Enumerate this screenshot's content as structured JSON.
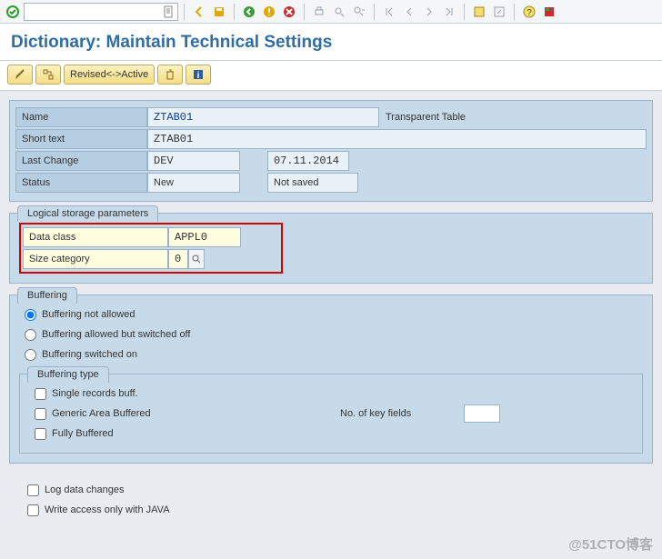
{
  "toolbar": {
    "ok_tip": "Enter",
    "combo_value": ""
  },
  "page_title": "Dictionary: Maintain Technical Settings",
  "local_toolbar": {
    "revise_label": "Revised<->Active"
  },
  "info": {
    "name_label": "Name",
    "name_value": "ZTAB01",
    "type_value": "Transparent Table",
    "short_text_label": "Short text",
    "short_text_value": "ZTAB01",
    "last_change_label": "Last Change",
    "last_change_user": "DEV",
    "last_change_date": "07.11.2014",
    "status_label": "Status",
    "status_value": "New",
    "saved_value": "Not saved"
  },
  "storage": {
    "group_title": "Logical storage parameters",
    "data_class_label": "Data class",
    "data_class_value": "APPL0",
    "size_cat_label": "Size category",
    "size_cat_value": "0"
  },
  "buffering": {
    "group_title": "Buffering",
    "opt_not_allowed": "Buffering not allowed",
    "opt_switched_off": "Buffering allowed but switched off",
    "opt_switched_on": "Buffering switched on",
    "selected": "not_allowed"
  },
  "buffering_type": {
    "group_title": "Buffering type",
    "single": "Single records buff.",
    "generic": "Generic Area Buffered",
    "fully": "Fully Buffered",
    "key_fields_label": "No. of key fields",
    "key_fields_value": ""
  },
  "bottom": {
    "log_changes": "Log data changes",
    "write_java": "Write access only with JAVA"
  },
  "watermark": "@51CTO博客"
}
